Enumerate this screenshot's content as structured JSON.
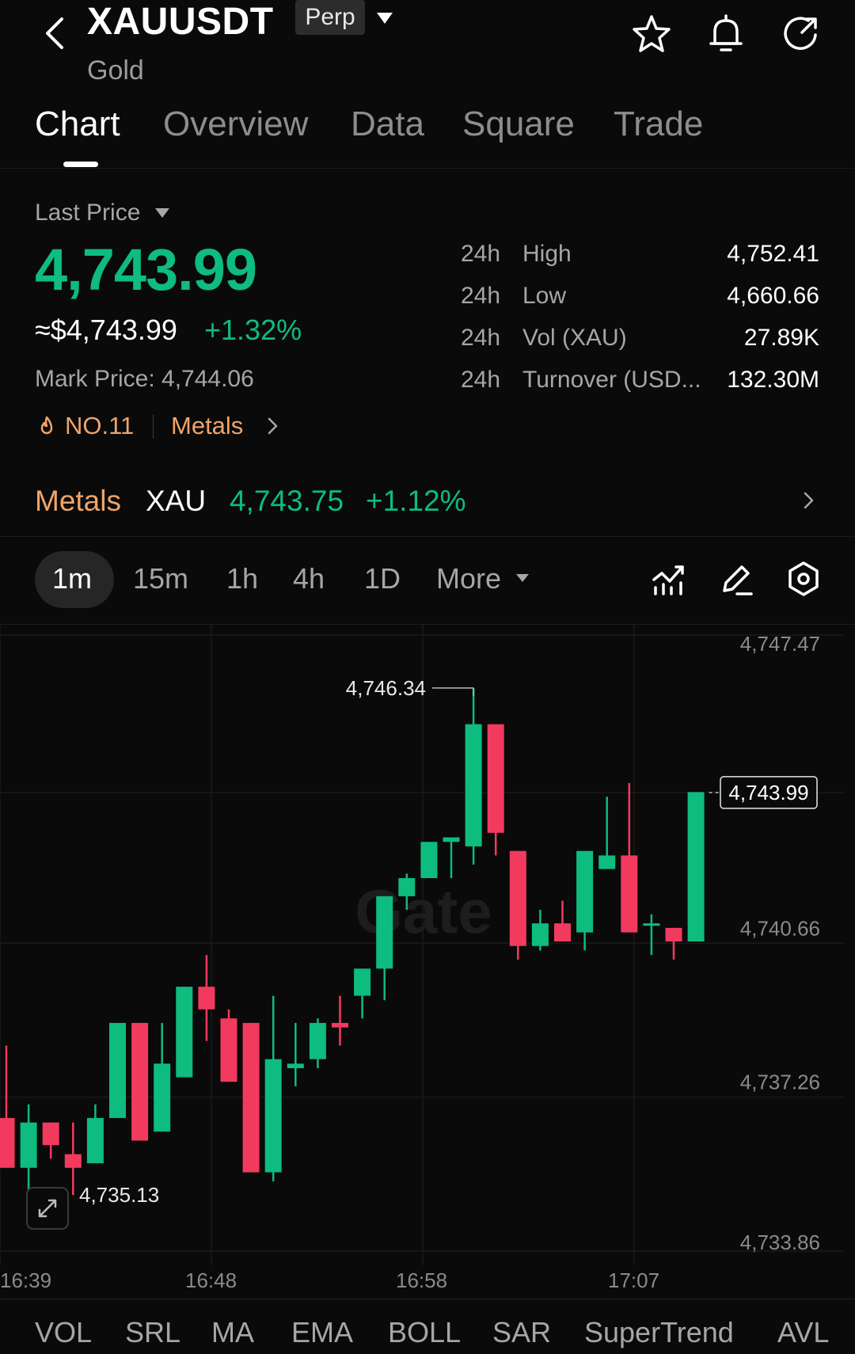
{
  "header": {
    "symbol": "XAUUSDT",
    "contract_badge": "Perp",
    "subname": "Gold",
    "icons": [
      "back-arrow-icon",
      "star-icon",
      "bell-icon",
      "share-icon"
    ]
  },
  "tabs": [
    {
      "label": "Chart",
      "active": true
    },
    {
      "label": "Overview",
      "active": false
    },
    {
      "label": "Data",
      "active": false
    },
    {
      "label": "Square",
      "active": false
    },
    {
      "label": "Trade",
      "active": false
    }
  ],
  "price": {
    "label": "Last Price",
    "last": "4,743.99",
    "approx_usd": "≈$4,743.99",
    "change_pct": "+1.32%",
    "mark_price": "Mark Price: 4,744.06",
    "rank": "NO.11",
    "sector": "Metals"
  },
  "stats": [
    {
      "period": "24h",
      "label": "High",
      "value": "4,752.41"
    },
    {
      "period": "24h",
      "label": "Low",
      "value": "4,660.66"
    },
    {
      "period": "24h",
      "label": "Vol (XAU)",
      "value": "27.89K"
    },
    {
      "period": "24h",
      "label": "Turnover (USD...",
      "value": "132.30M"
    }
  ],
  "metals_row": {
    "label": "Metals",
    "symbol": "XAU",
    "price": "4,743.75",
    "change": "+1.12%"
  },
  "intervals": {
    "items": [
      "1m",
      "15m",
      "1h",
      "4h",
      "1D",
      "More"
    ],
    "active": "1m"
  },
  "colors": {
    "up": "#0dbc7e",
    "down": "#f23a5f",
    "accent_orange": "#f0a469",
    "background": "#0a0a0a"
  },
  "chart_data": {
    "type": "candlestick",
    "y_ticks": [
      "4,747.47",
      "4,743.99",
      "4,740.66",
      "4,737.26",
      "4,733.86"
    ],
    "ylim": [
      4733.86,
      4747.47
    ],
    "x_ticks": [
      "16:39",
      "16:48",
      "16:58",
      "17:07"
    ],
    "high_label": "4,746.34",
    "low_label": "4,735.13",
    "current_price_label": "4,743.99",
    "watermark": "Gate",
    "candles": [
      {
        "o": 4736.8,
        "h": 4738.4,
        "l": 4735.7,
        "c": 4735.7
      },
      {
        "o": 4735.7,
        "h": 4737.1,
        "l": 4735.2,
        "c": 4736.7
      },
      {
        "o": 4736.7,
        "h": 4736.7,
        "l": 4735.9,
        "c": 4736.2
      },
      {
        "o": 4736.0,
        "h": 4736.7,
        "l": 4735.1,
        "c": 4735.7
      },
      {
        "o": 4735.8,
        "h": 4737.1,
        "l": 4735.8,
        "c": 4736.8
      },
      {
        "o": 4736.8,
        "h": 4738.2,
        "l": 4736.8,
        "c": 4738.9
      },
      {
        "o": 4738.9,
        "h": 4738.9,
        "l": 4736.3,
        "c": 4736.3
      },
      {
        "o": 4736.5,
        "h": 4738.9,
        "l": 4736.5,
        "c": 4738.0
      },
      {
        "o": 4737.7,
        "h": 4739.7,
        "l": 4737.7,
        "c": 4739.7
      },
      {
        "o": 4739.7,
        "h": 4740.4,
        "l": 4738.5,
        "c": 4739.2
      },
      {
        "o": 4739.0,
        "h": 4739.2,
        "l": 4737.6,
        "c": 4737.6
      },
      {
        "o": 4738.9,
        "h": 4738.9,
        "l": 4735.6,
        "c": 4735.6
      },
      {
        "o": 4735.6,
        "h": 4739.5,
        "l": 4735.4,
        "c": 4738.1
      },
      {
        "o": 4737.9,
        "h": 4738.9,
        "l": 4737.5,
        "c": 4738.0
      },
      {
        "o": 4738.1,
        "h": 4739.0,
        "l": 4737.9,
        "c": 4738.9
      },
      {
        "o": 4738.9,
        "h": 4739.5,
        "l": 4738.4,
        "c": 4738.8
      },
      {
        "o": 4739.5,
        "h": 4740.0,
        "l": 4739.0,
        "c": 4740.1
      },
      {
        "o": 4740.1,
        "h": 4741.1,
        "l": 4739.4,
        "c": 4741.7
      },
      {
        "o": 4741.7,
        "h": 4742.2,
        "l": 4741.4,
        "c": 4742.1
      },
      {
        "o": 4742.1,
        "h": 4742.9,
        "l": 4742.1,
        "c": 4742.9
      },
      {
        "o": 4742.9,
        "h": 4743.0,
        "l": 4742.1,
        "c": 4743.0
      },
      {
        "o": 4742.8,
        "h": 4746.3,
        "l": 4742.4,
        "c": 4745.5
      },
      {
        "o": 4745.5,
        "h": 4745.5,
        "l": 4742.6,
        "c": 4743.1
      },
      {
        "o": 4742.7,
        "h": 4742.7,
        "l": 4740.3,
        "c": 4740.6
      },
      {
        "o": 4740.6,
        "h": 4741.4,
        "l": 4740.5,
        "c": 4741.1
      },
      {
        "o": 4741.1,
        "h": 4741.6,
        "l": 4740.8,
        "c": 4740.7
      },
      {
        "o": 4740.9,
        "h": 4742.7,
        "l": 4740.5,
        "c": 4742.7
      },
      {
        "o": 4742.3,
        "h": 4743.9,
        "l": 4742.3,
        "c": 4742.6
      },
      {
        "o": 4742.6,
        "h": 4744.2,
        "l": 4740.9,
        "c": 4740.9
      },
      {
        "o": 4741.1,
        "h": 4741.3,
        "l": 4740.4,
        "c": 4741.1
      },
      {
        "o": 4741.0,
        "h": 4741.0,
        "l": 4740.3,
        "c": 4740.7
      },
      {
        "o": 4740.7,
        "h": 4744.0,
        "l": 4740.7,
        "c": 4744.0
      }
    ]
  },
  "indicators": [
    "VOL",
    "SRL",
    "MA",
    "EMA",
    "BOLL",
    "SAR",
    "SuperTrend",
    "AVL"
  ]
}
